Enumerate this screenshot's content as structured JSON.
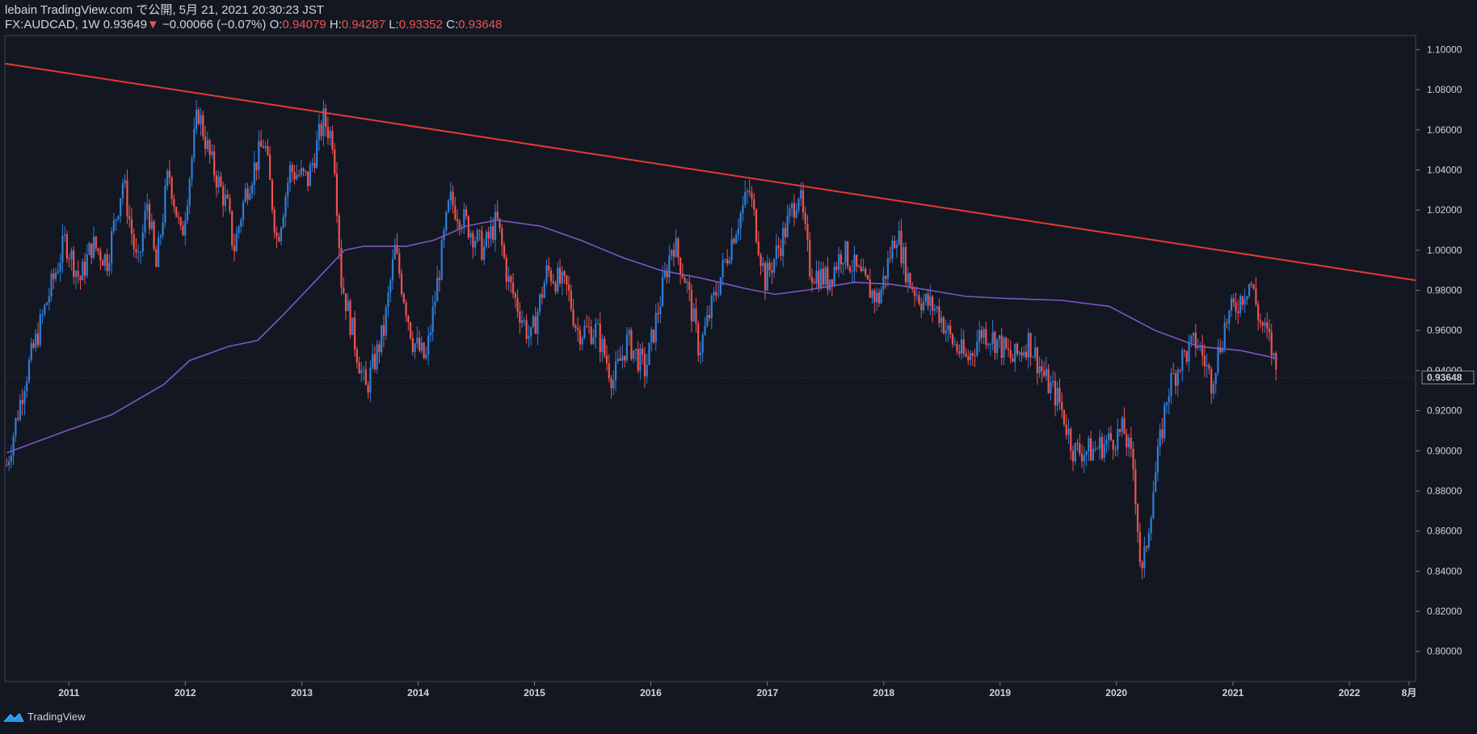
{
  "header": {
    "line1": "lebain TradingView.com で公開, 5月 21, 2021 20:30:23 JST",
    "symbol": "FX:AUDCAD, 1W",
    "last": "0.93649",
    "arrow": "▼",
    "change": "−0.00066 (−0.07%)",
    "o_label": "O:",
    "o_value": "0.94079",
    "h_label": "H:",
    "h_value": "0.94287",
    "l_label": "L:",
    "l_value": "0.93352",
    "c_label": "C:",
    "c_value": "0.93648"
  },
  "footer": {
    "brand": "TradingView",
    "logo_icon": "tradingview-logo-icon"
  },
  "chart_data": {
    "type": "candlestick",
    "symbol": "FX:AUDCAD",
    "interval": "1W",
    "y_axis": {
      "ticks": [
        "1.10000",
        "1.08000",
        "1.06000",
        "1.04000",
        "1.02000",
        "1.00000",
        "0.98000",
        "0.96000",
        "0.94000",
        "0.92000",
        "0.90000",
        "0.88000",
        "0.86000",
        "0.84000",
        "0.82000",
        "0.80000"
      ],
      "range": [
        0.785,
        1.107
      ],
      "last_price_label": "0.93648"
    },
    "x_axis": {
      "ticks": [
        "2011",
        "2012",
        "2013",
        "2014",
        "2015",
        "2016",
        "2017",
        "2018",
        "2019",
        "2020",
        "2021",
        "2022",
        "8月"
      ],
      "range": [
        "2010-06-14",
        "2022-07-28"
      ]
    },
    "colors": {
      "up": "#2f7fd8",
      "down": "#ef5350",
      "ma": "#7e57c2",
      "trendline": "#e53935",
      "background": "#131722",
      "text": "#d1d4dc",
      "grid": "#2a2e39"
    },
    "close_path": [
      [
        "2010-06-20",
        0.893
      ],
      [
        "2010-08-15",
        0.935
      ],
      [
        "2010-10-25",
        0.975
      ],
      [
        "2010-12-20",
        1.005
      ],
      [
        "2011-02-05",
        0.985
      ],
      [
        "2011-03-15",
        1.003
      ],
      [
        "2011-05-01",
        0.995
      ],
      [
        "2011-06-20",
        1.035
      ],
      [
        "2011-08-05",
        0.99
      ],
      [
        "2011-09-05",
        1.025
      ],
      [
        "2011-10-01",
        0.99
      ],
      [
        "2011-11-10",
        1.04
      ],
      [
        "2011-12-20",
        1.005
      ],
      [
        "2012-02-10",
        1.07
      ],
      [
        "2012-03-20",
        1.045
      ],
      [
        "2012-05-15",
        1.02
      ],
      [
        "2012-06-01",
        1.0
      ],
      [
        "2012-07-10",
        1.03
      ],
      [
        "2012-09-05",
        1.055
      ],
      [
        "2012-10-15",
        1.005
      ],
      [
        "2012-11-25",
        1.04
      ],
      [
        "2013-01-20",
        1.035
      ],
      [
        "2013-03-10",
        1.065
      ],
      [
        "2013-04-10",
        1.055
      ],
      [
        "2013-05-05",
        0.985
      ],
      [
        "2013-06-15",
        0.955
      ],
      [
        "2013-07-20",
        0.93
      ],
      [
        "2013-09-15",
        0.96
      ],
      [
        "2013-10-20",
        1.0
      ],
      [
        "2013-12-15",
        0.955
      ],
      [
        "2014-01-25",
        0.945
      ],
      [
        "2014-04-10",
        1.025
      ],
      [
        "2014-06-15",
        1.01
      ],
      [
        "2014-07-25",
        1.0
      ],
      [
        "2014-09-05",
        1.015
      ],
      [
        "2014-10-10",
        0.985
      ],
      [
        "2014-12-20",
        0.955
      ],
      [
        "2015-02-10",
        0.99
      ],
      [
        "2015-04-15",
        0.98
      ],
      [
        "2015-05-15",
        0.96
      ],
      [
        "2015-07-15",
        0.96
      ],
      [
        "2015-09-05",
        0.935
      ],
      [
        "2015-10-20",
        0.955
      ],
      [
        "2015-12-15",
        0.94
      ],
      [
        "2016-03-10",
        1.005
      ],
      [
        "2016-04-20",
        0.985
      ],
      [
        "2016-06-01",
        0.95
      ],
      [
        "2016-07-25",
        0.98
      ],
      [
        "2016-09-20",
        1.01
      ],
      [
        "2016-11-05",
        1.03
      ],
      [
        "2016-12-25",
        0.985
      ],
      [
        "2017-02-15",
        1.005
      ],
      [
        "2017-04-10",
        1.03
      ],
      [
        "2017-05-15",
        0.99
      ],
      [
        "2017-07-10",
        0.985
      ],
      [
        "2017-08-25",
        1.0
      ],
      [
        "2017-10-25",
        0.985
      ],
      [
        "2017-12-15",
        0.975
      ],
      [
        "2018-02-10",
        1.01
      ],
      [
        "2018-03-20",
        0.985
      ],
      [
        "2018-05-01",
        0.975
      ],
      [
        "2018-06-20",
        0.97
      ],
      [
        "2018-08-01",
        0.955
      ],
      [
        "2018-09-20",
        0.945
      ],
      [
        "2018-11-05",
        0.96
      ],
      [
        "2018-12-20",
        0.955
      ],
      [
        "2019-02-10",
        0.945
      ],
      [
        "2019-04-01",
        0.955
      ],
      [
        "2019-05-25",
        0.935
      ],
      [
        "2019-07-05",
        0.925
      ],
      [
        "2019-08-20",
        0.9
      ],
      [
        "2019-10-15",
        0.9
      ],
      [
        "2019-12-10",
        0.905
      ],
      [
        "2020-01-25",
        0.91
      ],
      [
        "2020-02-25",
        0.89
      ],
      [
        "2020-03-20",
        0.835
      ],
      [
        "2020-04-25",
        0.88
      ],
      [
        "2020-06-10",
        0.93
      ],
      [
        "2020-07-20",
        0.945
      ],
      [
        "2020-09-10",
        0.955
      ],
      [
        "2020-10-25",
        0.935
      ],
      [
        "2020-12-10",
        0.965
      ],
      [
        "2021-01-20",
        0.975
      ],
      [
        "2021-02-25",
        0.985
      ],
      [
        "2021-03-25",
        0.965
      ],
      [
        "2021-04-25",
        0.955
      ],
      [
        "2021-05-21",
        0.9365
      ]
    ],
    "moving_average": [
      [
        "2010-06-20",
        0.899
      ],
      [
        "2010-12-25",
        0.91
      ],
      [
        "2011-05-15",
        0.918
      ],
      [
        "2011-10-25",
        0.933
      ],
      [
        "2012-01-15",
        0.945
      ],
      [
        "2012-05-15",
        0.952
      ],
      [
        "2012-08-15",
        0.955
      ],
      [
        "2012-11-05",
        0.968
      ],
      [
        "2013-02-15",
        0.985
      ],
      [
        "2013-05-15",
        1.0
      ],
      [
        "2013-07-15",
        1.002
      ],
      [
        "2013-11-25",
        1.002
      ],
      [
        "2014-02-20",
        1.005
      ],
      [
        "2014-06-01",
        1.012
      ],
      [
        "2014-09-05",
        1.015
      ],
      [
        "2015-01-20",
        1.012
      ],
      [
        "2015-05-25",
        1.005
      ],
      [
        "2015-10-10",
        0.996
      ],
      [
        "2016-02-01",
        0.99
      ],
      [
        "2016-06-10",
        0.986
      ],
      [
        "2016-10-20",
        0.981
      ],
      [
        "2017-01-25",
        0.978
      ],
      [
        "2017-05-01",
        0.98
      ],
      [
        "2017-10-01",
        0.984
      ],
      [
        "2018-01-25",
        0.983
      ],
      [
        "2018-05-25",
        0.98
      ],
      [
        "2018-09-15",
        0.977
      ],
      [
        "2019-01-15",
        0.976
      ],
      [
        "2019-07-15",
        0.975
      ],
      [
        "2019-12-10",
        0.972
      ],
      [
        "2020-05-01",
        0.96
      ],
      [
        "2020-09-15",
        0.952
      ],
      [
        "2021-01-25",
        0.95
      ],
      [
        "2021-05-21",
        0.946
      ]
    ],
    "trendline": {
      "from": [
        "2010-06-14",
        1.093
      ],
      "to": [
        "2022-07-28",
        0.985
      ]
    }
  }
}
